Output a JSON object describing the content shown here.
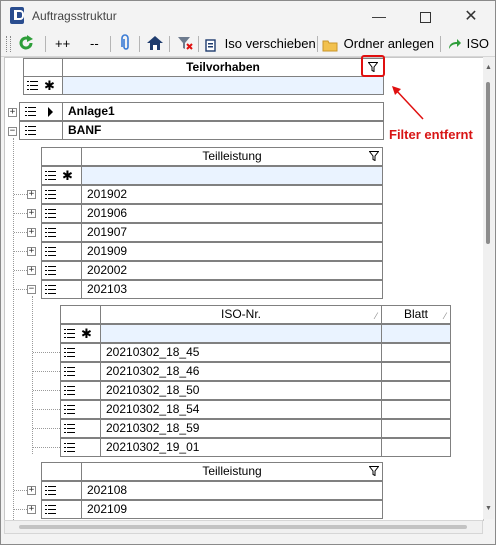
{
  "window": {
    "title": "Auftragsstruktur"
  },
  "window_controls": {
    "minimize": "—",
    "close": "✕"
  },
  "toolbar": {
    "expand_all": "++",
    "collapse_all": "--",
    "iso_move": "Iso verschieben",
    "create_folder": "Ordner anlegen",
    "iso": "ISO"
  },
  "top_grid": {
    "header": "Teilvorhaben",
    "rows": [
      "Anlage1",
      "BANF"
    ]
  },
  "teilleistung_1": {
    "header": "Teilleistung",
    "rows": [
      "201902",
      "201906",
      "201907",
      "201909",
      "202002",
      "202103"
    ]
  },
  "iso_grid": {
    "headers": [
      "ISO-Nr.",
      "Blatt"
    ],
    "rows": [
      "20210302_18_45",
      "20210302_18_46",
      "20210302_18_50",
      "20210302_18_54",
      "20210302_18_59",
      "20210302_19_01"
    ]
  },
  "teilleistung_2": {
    "header": "Teilleistung",
    "rows": [
      "202108",
      "202109"
    ]
  },
  "annotation": {
    "text": "Filter entfernt"
  },
  "colors": {
    "annotation": "#e01010",
    "new_row": "#eaf3ff",
    "accent_green": "#2e9e3a"
  }
}
